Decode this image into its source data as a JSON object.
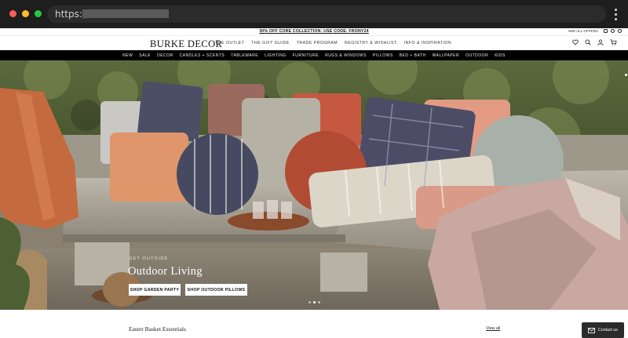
{
  "browser": {
    "url_prefix": "https://",
    "traffic_light_colors": [
      "#fe5f57",
      "#febc2e",
      "#28c840"
    ]
  },
  "promo": {
    "text": "30% OFF CORE COLLECTION: USE CODE: FRONY24",
    "offers": "SEE ALL OFFERS",
    "social_icons": [
      "instagram-icon",
      "facebook-icon",
      "pinterest-icon"
    ]
  },
  "header": {
    "logo": "BURKE DECOR",
    "nav": [
      "THE OUTLET",
      "THE GIFT GUIDE",
      "TRADE PROGRAM",
      "REGISTRY & WISHLIST",
      "INFO & INSPIRATION"
    ],
    "icons": [
      "heart-icon",
      "search-icon",
      "account-icon",
      "cart-icon"
    ]
  },
  "categories": [
    "NEW",
    "SALE",
    "DECOR",
    "CANDLES + SCENTS",
    "TABLEWARE",
    "LIGHTING",
    "FURNITURE",
    "RUGS & WINDOWS",
    "PILLOWS",
    "BED + BATH",
    "WALLPAPER",
    "OUTDOOR",
    "KIDS"
  ],
  "hero": {
    "eyebrow": "GET OUTSIDE",
    "title": "Outdoor Living",
    "buttons": [
      "SHOP GARDEN PARTY",
      "SHOP OUTDOOR PILLOWS"
    ],
    "slides": 3,
    "active_slide": 1
  },
  "section": {
    "title": "Easter Basket Essentials",
    "view_all": "View all"
  },
  "contact": {
    "label": "Contact us"
  }
}
